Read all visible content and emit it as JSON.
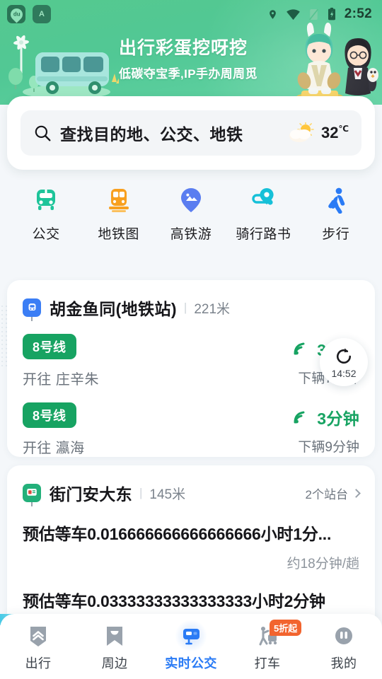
{
  "statusbar": {
    "time": "2:52",
    "notifications": [
      {
        "name": "du-map-icon",
        "label": "du"
      },
      {
        "name": "a-app-icon",
        "label": "A"
      }
    ],
    "icons": [
      "location-icon",
      "wifi-icon",
      "signal-off-icon",
      "battery-charging-icon"
    ]
  },
  "banner": {
    "title": "出行彩蛋挖呀挖",
    "subtitle": "低碳夺宝季,IP手办周周觅"
  },
  "search": {
    "placeholder": "查找目的地、公交、地铁",
    "icon": "search-icon",
    "weather_icon": "sun-cloud-icon",
    "temperature": "32",
    "temperature_unit": "℃"
  },
  "quick_actions": [
    {
      "label": "公交",
      "icon": "bus-icon",
      "color": "#1ec49a"
    },
    {
      "label": "地铁图",
      "icon": "metro-icon",
      "color": "#f8a020"
    },
    {
      "label": "高铁游",
      "icon": "pin-photo-icon",
      "color": "#5a7df0"
    },
    {
      "label": "骑行路书",
      "icon": "route-pin-icon",
      "color": "#16c0d8"
    },
    {
      "label": "步行",
      "icon": "walking-icon",
      "color": "#2a7bf5"
    }
  ],
  "metro_card": {
    "icon": "metro-station-icon",
    "name": "胡金鱼同(地铁站)",
    "separator": "|",
    "distance": "221米",
    "lines": [
      {
        "badge": "8号线",
        "destination": "开往 庄辛朱",
        "eta": "3分钟",
        "next": "下辆7分钟",
        "signal_icon": "signal-wave-icon"
      },
      {
        "badge": "8号线",
        "destination": "开往 瀛海",
        "eta": "3分钟",
        "next": "下辆9分钟",
        "signal_icon": "signal-wave-icon"
      }
    ]
  },
  "refresh": {
    "icon": "refresh-icon",
    "time": "14:52"
  },
  "bus_card": {
    "icon": "bus-station-icon",
    "name": "街门安大东",
    "separator": "|",
    "distance": "145米",
    "platforms_label": "2个站台",
    "chevron": "chevron-right-icon",
    "rows": [
      {
        "main": "预估等车0.016666666666666666小时1分...",
        "sub": "约18分钟/趟"
      },
      {
        "main": "预估等车0.03333333333333333小时2分钟",
        "sub": ""
      }
    ]
  },
  "navbar": {
    "items": [
      {
        "label": "出行",
        "icon": "chevrons-up-icon",
        "active": false,
        "badge": ""
      },
      {
        "label": "周边",
        "icon": "bookmark-icon",
        "active": false,
        "badge": ""
      },
      {
        "label": "实时公交",
        "icon": "realtime-bus-icon",
        "active": true,
        "badge": ""
      },
      {
        "label": "打车",
        "icon": "hail-taxi-icon",
        "active": false,
        "badge": "5折起"
      },
      {
        "label": "我的",
        "icon": "profile-icon",
        "active": false,
        "badge": ""
      }
    ],
    "active_color": "#2a7bf5"
  }
}
